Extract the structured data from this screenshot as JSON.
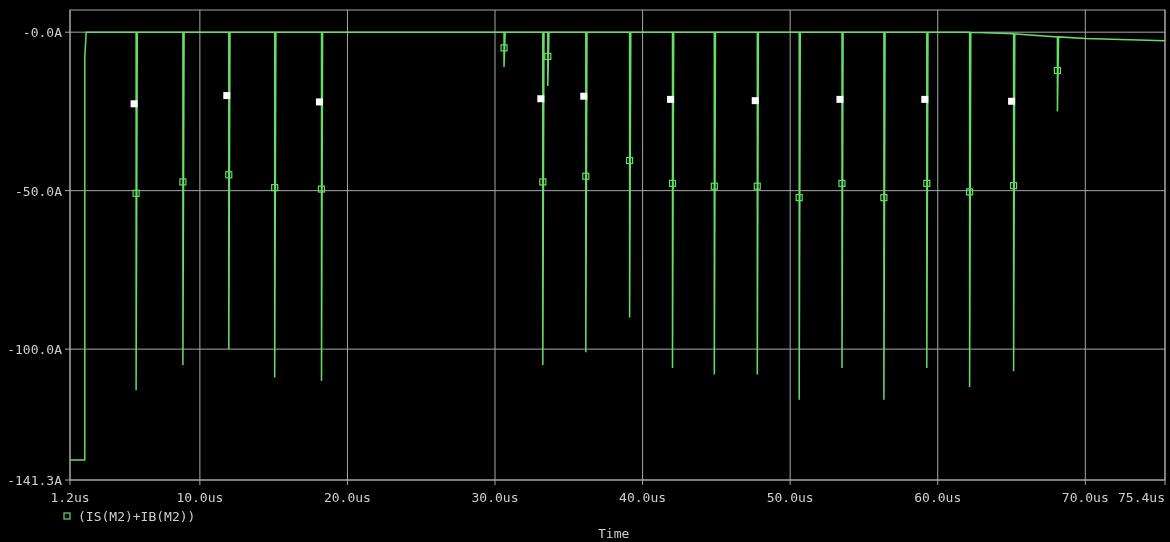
{
  "plot": {
    "chart_data": {
      "type": "line",
      "xlabel": "Time",
      "grid": true,
      "xlim": [
        1.2,
        75.4
      ],
      "ylim": [
        -141.3,
        7
      ],
      "xticks": [
        {
          "value": 1.2,
          "label": "1.2us"
        },
        {
          "value": 10,
          "label": "10.0us"
        },
        {
          "value": 20,
          "label": "20.0us"
        },
        {
          "value": 30,
          "label": "30.0us"
        },
        {
          "value": 40,
          "label": "40.0us"
        },
        {
          "value": 50,
          "label": "50.0us"
        },
        {
          "value": 60,
          "label": "60.0us"
        },
        {
          "value": 70,
          "label": "70.0us"
        },
        {
          "value": 75.4,
          "label": "75.4us"
        }
      ],
      "yticks": [
        {
          "value": 0,
          "label": "-0.0A"
        },
        {
          "value": -50,
          "label": "-50.0A"
        },
        {
          "value": -100,
          "label": "-100.0A"
        },
        {
          "value": -141.3,
          "label": "-141.3A"
        }
      ],
      "x": [
        1.2,
        2.2,
        2.2,
        2.3,
        5.68,
        5.68,
        5.76,
        8.85,
        8.85,
        8.93,
        11.96,
        11.96,
        12.04,
        15.07,
        15.07,
        15.15,
        18.24,
        18.24,
        18.32,
        30.61,
        30.61,
        30.69,
        33.24,
        33.24,
        33.32,
        33.58,
        33.58,
        33.66,
        36.15,
        36.15,
        36.23,
        39.12,
        39.12,
        39.2,
        42.03,
        42.03,
        42.11,
        44.86,
        44.86,
        44.94,
        47.77,
        47.77,
        47.85,
        50.61,
        50.61,
        50.69,
        53.51,
        53.51,
        53.59,
        56.35,
        56.35,
        56.43,
        59.26,
        59.26,
        59.34,
        62.16,
        62.16,
        62.24,
        65.14,
        65.14,
        65.22,
        68.11,
        68.11,
        68.19,
        70,
        75.4
      ],
      "series": [
        {
          "name": "(IS(M2)+IB(M2))",
          "color": "#66dd66",
          "values": [
            -135,
            -135,
            -8,
            0,
            0,
            -113,
            0,
            0,
            -105,
            0,
            0,
            -100,
            0,
            0,
            -109,
            0,
            0,
            -110,
            0,
            0,
            -11,
            0,
            0,
            -105,
            0,
            0,
            -17,
            0,
            0,
            -101,
            0,
            0,
            -90,
            0,
            0,
            -106,
            0,
            0,
            -108,
            0,
            0,
            -108,
            0,
            0,
            -116,
            0,
            0,
            -106,
            0,
            0,
            -116,
            0,
            0,
            -106,
            0,
            0,
            -112,
            0,
            -0.5,
            -107,
            -0.5,
            -1.5,
            -25,
            -1.5,
            -2,
            -2.7
          ]
        }
      ]
    }
  }
}
